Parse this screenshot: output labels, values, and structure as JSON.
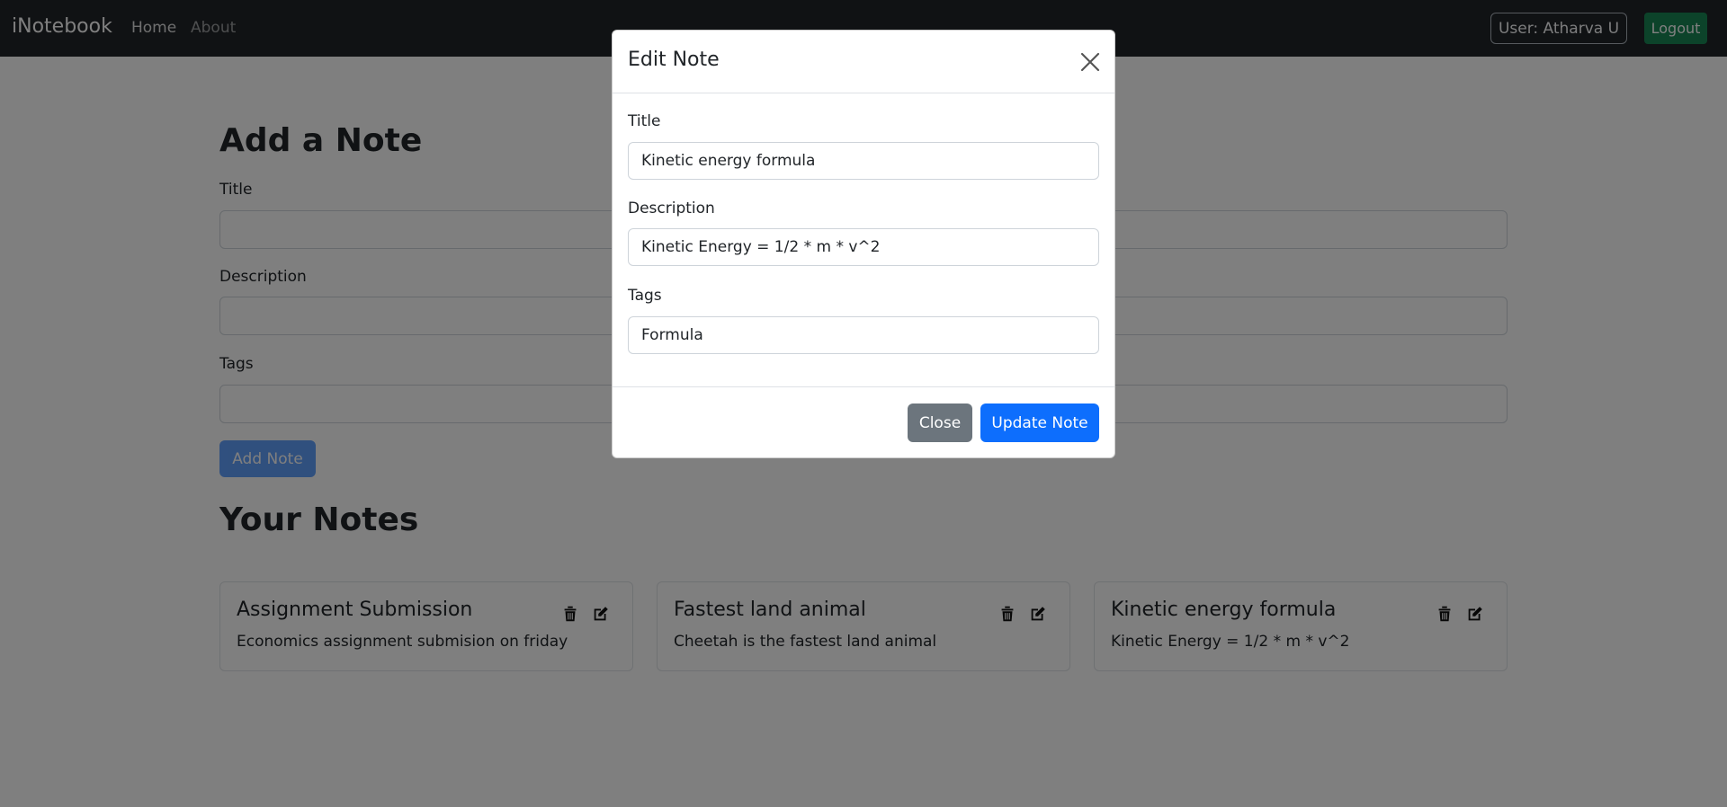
{
  "navbar": {
    "brand": "iNotebook",
    "links": [
      {
        "label": "Home",
        "active": true
      },
      {
        "label": "About",
        "active": false
      }
    ],
    "user_badge": "User: Atharva U",
    "logout_label": "Logout"
  },
  "add_note": {
    "heading": "Add a Note",
    "title_label": "Title",
    "description_label": "Description",
    "tags_label": "Tags",
    "title_value": "",
    "description_value": "",
    "tags_value": "",
    "submit_label": "Add Note"
  },
  "your_notes": {
    "heading": "Your Notes",
    "notes": [
      {
        "title": "Assignment Submission",
        "description": "Economics assignment submision on friday"
      },
      {
        "title": "Fastest land animal",
        "description": "Cheetah is the fastest land animal"
      },
      {
        "title": "Kinetic energy formula",
        "description": "Kinetic Energy = 1/2 * m * v^2"
      }
    ]
  },
  "modal": {
    "title": "Edit Note",
    "title_label": "Title",
    "title_value": "Kinetic energy formula",
    "description_label": "Description",
    "description_value": "Kinetic Energy = 1/2 * m * v^2",
    "tags_label": "Tags",
    "tags_value": "Formula",
    "close_label": "Close",
    "update_label": "Update Note"
  },
  "icons": {
    "delete": "trash-icon",
    "edit": "edit-icon",
    "modal_close": "close-icon"
  },
  "colors": {
    "navbar_bg": "#212529",
    "primary": "#0d6efd",
    "success": "#198754",
    "secondary": "#6c757d"
  }
}
